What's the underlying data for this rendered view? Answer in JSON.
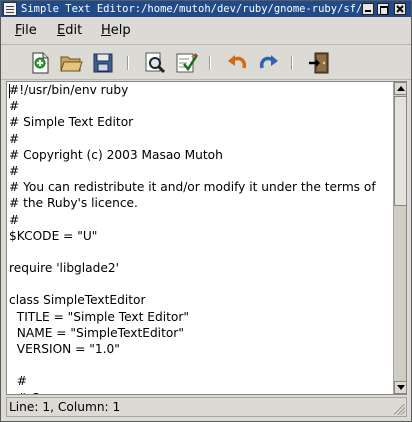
{
  "window": {
    "title": "Simple Text Editor:/home/mutoh/dev/ruby/gnome-ruby/sf/c"
  },
  "menubar": {
    "file": "ile",
    "file_mnemonic": "F",
    "edit": "dit",
    "edit_mnemonic": "E",
    "help": "elp",
    "help_mnemonic": "H"
  },
  "toolbar": {
    "icons": [
      "new-icon",
      "open-icon",
      "save-icon",
      "find-icon",
      "spellcheck-icon",
      "undo-icon",
      "redo-icon",
      "quit-icon"
    ]
  },
  "editor": {
    "lines": [
      "#!/usr/bin/env ruby",
      "#",
      "# Simple Text Editor",
      "#",
      "# Copyright (c) 2003 Masao Mutoh",
      "#",
      "# You can redistribute it and/or modify it under the terms of",
      "# the Ruby's licence.",
      "#",
      "$KCODE = \"U\"",
      "",
      "require 'libglade2'",
      "",
      "class SimpleTextEditor",
      "  TITLE = \"Simple Text Editor\"",
      "  NAME = \"SimpleTextEditor\"",
      "  VERSION = \"1.0\"",
      "",
      "  #",
      "  # Common"
    ]
  },
  "statusbar": {
    "text": "Line: 1, Column: 1"
  },
  "colors": {
    "titlebar": "#1f4b8a",
    "chrome": "#dcdad5",
    "editor_bg": "#ffffff"
  }
}
